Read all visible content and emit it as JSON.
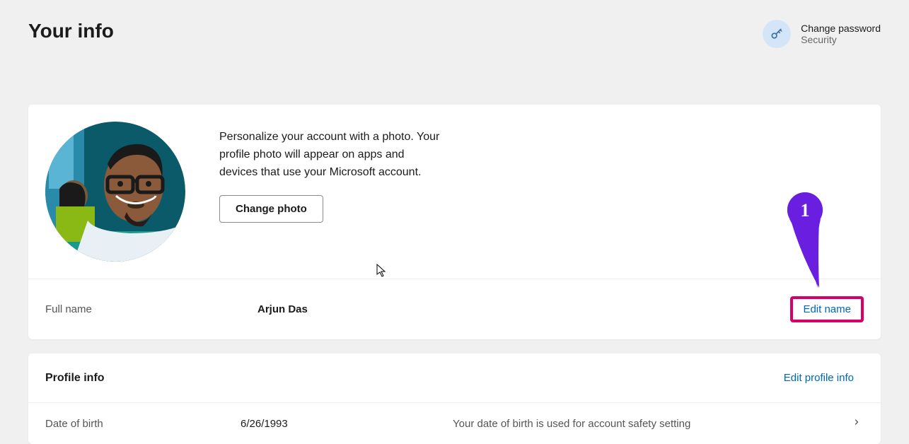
{
  "header": {
    "title": "Your info",
    "changePassword": {
      "title": "Change password",
      "subtitle": "Security"
    }
  },
  "photoSection": {
    "description": "Personalize your account with a photo. Your profile photo will appear on apps and devices that use your Microsoft account.",
    "changePhotoLabel": "Change photo"
  },
  "nameRow": {
    "label": "Full name",
    "value": "Arjun Das",
    "editLabel": "Edit name"
  },
  "profileInfo": {
    "title": "Profile info",
    "editLabel": "Edit profile info",
    "dobLabel": "Date of birth",
    "dobValue": "6/26/1993",
    "dobDescription": "Your date of birth is used for account safety setting"
  },
  "annotation": {
    "number": "1"
  }
}
